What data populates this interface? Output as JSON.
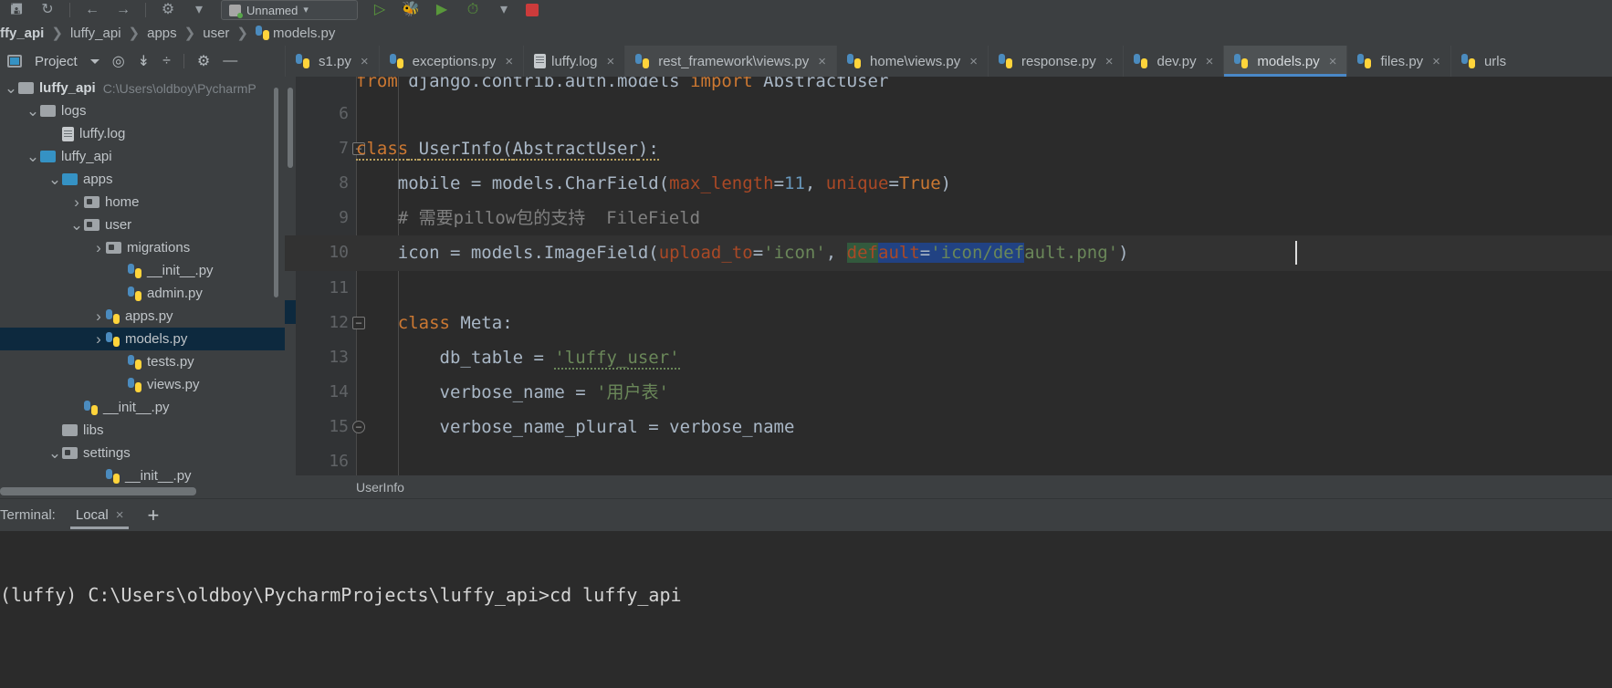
{
  "window": {
    "app": "PyCharm",
    "run_config": "Unnamed"
  },
  "toolbar": {
    "icons": [
      {
        "name": "save-icon",
        "glyph": "὚b"
      },
      {
        "name": "sync-icon",
        "glyph": "↻"
      },
      {
        "name": "back-icon",
        "glyph": "←"
      },
      {
        "name": "forward-icon",
        "glyph": "→"
      },
      {
        "name": "profile-icon",
        "glyph": "⛉"
      }
    ],
    "run_config_label": "Unnamed",
    "run_label": "Run",
    "debug_label": "Debug",
    "coverage_label": "Run with Coverage",
    "profile_label": "Profile",
    "stop_label": "Stop"
  },
  "breadcrumb": {
    "items": [
      "ffy_api",
      "luffy_api",
      "apps",
      "user"
    ],
    "file": "models.py",
    "separator": "❯"
  },
  "project_panel": {
    "title": "Project",
    "icons": [
      "locate-icon",
      "collapse-all-icon",
      "expand-icon",
      "settings-gear-icon",
      "hide-icon"
    ]
  },
  "editor_tabs": [
    {
      "label": "s1.py",
      "icon": "python-file-icon",
      "active": false,
      "close": "×"
    },
    {
      "label": "exceptions.py",
      "icon": "python-file-icon",
      "active": false,
      "close": "×"
    },
    {
      "label": "luffy.log",
      "icon": "log-file-icon",
      "active": false,
      "close": "×"
    },
    {
      "label": "rest_framework\\views.py",
      "icon": "python-file-icon",
      "active": false,
      "close": "×",
      "highlight": true
    },
    {
      "label": "home\\views.py",
      "icon": "python-file-icon",
      "active": false,
      "close": "×"
    },
    {
      "label": "response.py",
      "icon": "python-file-icon",
      "active": false,
      "close": "×"
    },
    {
      "label": "dev.py",
      "icon": "python-file-icon",
      "active": false,
      "close": "×"
    },
    {
      "label": "models.py",
      "icon": "python-file-icon",
      "active": true,
      "close": "×"
    },
    {
      "label": "files.py",
      "icon": "python-file-icon",
      "active": false,
      "close": "×"
    },
    {
      "label": "urls",
      "icon": "python-file-icon",
      "active": false,
      "close": ""
    }
  ],
  "project_tree": [
    {
      "indent": 0,
      "arrow": "⌄",
      "icon": "folder",
      "label": "luffy_api",
      "bold": true,
      "path": "C:\\Users\\oldboy\\PycharmP",
      "selected": false
    },
    {
      "indent": 1,
      "arrow": "⌄",
      "icon": "folder",
      "label": "logs",
      "bold": false,
      "selected": false
    },
    {
      "indent": 2,
      "arrow": "",
      "icon": "log",
      "label": "luffy.log",
      "bold": false,
      "selected": false
    },
    {
      "indent": 1,
      "arrow": "⌄",
      "icon": "folder-blue",
      "label": "luffy_api",
      "bold": false,
      "selected": false
    },
    {
      "indent": 2,
      "arrow": "⌄",
      "icon": "folder-blue",
      "label": "apps",
      "bold": false,
      "selected": false
    },
    {
      "indent": 3,
      "arrow": "›",
      "icon": "folder-mod",
      "label": "home",
      "bold": false,
      "selected": false
    },
    {
      "indent": 3,
      "arrow": "⌄",
      "icon": "folder-mod",
      "label": "user",
      "bold": false,
      "selected": false
    },
    {
      "indent": 4,
      "arrow": "›",
      "icon": "folder-mod",
      "label": "migrations",
      "bold": false,
      "selected": false
    },
    {
      "indent": 5,
      "arrow": "",
      "icon": "py",
      "label": "__init__.py",
      "bold": false,
      "selected": false
    },
    {
      "indent": 5,
      "arrow": "",
      "icon": "py",
      "label": "admin.py",
      "bold": false,
      "selected": false
    },
    {
      "indent": 4,
      "arrow": "›",
      "icon": "py",
      "label": "apps.py",
      "bold": false,
      "selected": false
    },
    {
      "indent": 4,
      "arrow": "›",
      "icon": "py",
      "label": "models.py",
      "bold": false,
      "selected": true
    },
    {
      "indent": 5,
      "arrow": "",
      "icon": "py",
      "label": "tests.py",
      "bold": false,
      "selected": false
    },
    {
      "indent": 5,
      "arrow": "",
      "icon": "py",
      "label": "views.py",
      "bold": false,
      "selected": false
    },
    {
      "indent": 3,
      "arrow": "",
      "icon": "py",
      "label": "__init__.py",
      "bold": false,
      "selected": false
    },
    {
      "indent": 2,
      "arrow": "",
      "icon": "folder",
      "label": "libs",
      "bold": false,
      "selected": false
    },
    {
      "indent": 2,
      "arrow": "⌄",
      "icon": "folder-mod",
      "label": "settings",
      "bold": false,
      "selected": false
    },
    {
      "indent": 4,
      "arrow": "",
      "icon": "py",
      "label": "__init__.py",
      "bold": false,
      "selected": false
    }
  ],
  "code": {
    "breadcrumb": "UserInfo",
    "lines": [
      {
        "num": "",
        "text": "from django.contrib.auth.models import AbstractUser",
        "partial": true
      },
      {
        "num": "6",
        "text": ""
      },
      {
        "num": "7",
        "text": "class UserInfo(AbstractUser):",
        "fold": "-"
      },
      {
        "num": "8",
        "text": "    mobile = models.CharField(max_length=11, unique=True)"
      },
      {
        "num": "9",
        "text": "    # 需要pillow包的支持  FileField"
      },
      {
        "num": "10",
        "text": "    icon = models.ImageField(upload_to='icon', default='icon/default.png')",
        "current": true
      },
      {
        "num": "11",
        "text": ""
      },
      {
        "num": "12",
        "text": "    class Meta:",
        "fold": "-"
      },
      {
        "num": "13",
        "text": "        db_table = 'luffy_user'"
      },
      {
        "num": "14",
        "text": "        verbose_name = '用户表'"
      },
      {
        "num": "15",
        "text": "        verbose_name_plural = verbose_name",
        "fold": "o"
      },
      {
        "num": "16",
        "text": ""
      }
    ],
    "selection": {
      "search_highlight_text": "def",
      "selected_text": "ault='icon/def",
      "search_highlight_color": "#32593d",
      "selection_color": "#214283"
    }
  },
  "terminal": {
    "label": "Terminal:",
    "tab": "Local",
    "close": "×",
    "add": "+",
    "prompt_line": "(luffy) C:\\Users\\oldboy\\PycharmProjects\\luffy_api>cd luffy_api"
  },
  "colors": {
    "bg_chrome": "#3c3f41",
    "bg_editor": "#2b2b2b",
    "accent_tab": "#4a88c7",
    "selection_blue": "#214283",
    "search_green": "#32593d",
    "tree_selected": "#0d293e"
  }
}
